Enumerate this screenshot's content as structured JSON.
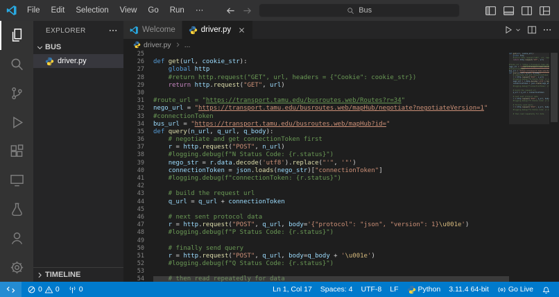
{
  "colors": {
    "accent": "#007acc",
    "titlebar_bg": "#323233",
    "activitybar_bg": "#333333",
    "sidebar_bg": "#252526",
    "editor_bg": "#1e1e1e",
    "tab_inactive_bg": "#2d2d2d",
    "statusbar_bg": "#007acc",
    "vscode_blue": "#29a9e1",
    "python_blue": "#3776ab",
    "python_yellow": "#ffd43b",
    "syntax": {
      "keyword": "#569cd6",
      "control": "#c586c0",
      "function": "#dcdcaa",
      "variable": "#9cdcfe",
      "string": "#ce9178",
      "comment": "#6a9955",
      "escape": "#d7ba7d",
      "punct": "#d4d4d4"
    }
  },
  "title_bar": {
    "menus": [
      "File",
      "Edit",
      "Selection",
      "View",
      "Go",
      "Run",
      "⋯"
    ],
    "nav": [
      "back-arrow-icon",
      "forward-arrow-icon"
    ],
    "search": {
      "value": "Bus",
      "icon": "search-icon"
    },
    "layout_icons": [
      "layout-sidebar-left-icon",
      "layout-panel-icon",
      "layout-sidebar-right-icon",
      "customize-layout-icon"
    ]
  },
  "activity_bar": {
    "items": [
      {
        "name": "explorer",
        "icon": "files-icon",
        "active": true
      },
      {
        "name": "search",
        "icon": "search-icon",
        "active": false
      },
      {
        "name": "source-control",
        "icon": "source-control-icon",
        "active": false
      },
      {
        "name": "run-and-debug",
        "icon": "run-and-debug-icon",
        "active": false
      },
      {
        "name": "extensions",
        "icon": "extensions-icon",
        "active": false
      },
      {
        "name": "remote-explorer",
        "icon": "remote-explorer-icon",
        "active": false
      },
      {
        "name": "testing",
        "icon": "testing-icon",
        "active": false
      }
    ],
    "bottom": [
      {
        "name": "account",
        "icon": "account-icon",
        "active": false
      },
      {
        "name": "settings",
        "icon": "settings-gear-icon",
        "active": false
      }
    ]
  },
  "sidebar": {
    "title": "EXPLORER",
    "folder": "BUS",
    "files": [
      {
        "name": "driver.py",
        "icon": "python-file-icon",
        "selected": true
      }
    ],
    "timeline": "TIMELINE"
  },
  "tabs": {
    "items": [
      {
        "label": "Welcome",
        "icon": "vscode-logo-icon",
        "active": false
      },
      {
        "label": "driver.py",
        "icon": "python-file-icon",
        "active": true
      }
    ]
  },
  "editor_actions": [
    "run-icon",
    "chevron-down-icon",
    "split-editor-icon",
    "ellipsis-icon"
  ],
  "breadcrumb": {
    "file": "driver.py",
    "more": "..."
  },
  "editor": {
    "lines": [
      {
        "n": "25",
        "s": []
      },
      {
        "n": "26",
        "s": [
          [
            "kw",
            "def"
          ],
          [
            "pl",
            " "
          ],
          [
            "fn",
            "get"
          ],
          [
            "pu",
            "("
          ],
          [
            "va",
            "url"
          ],
          [
            "pu",
            ", "
          ],
          [
            "va",
            "cookie_str"
          ],
          [
            "pu",
            "):"
          ]
        ]
      },
      {
        "n": "27",
        "s": [
          [
            "pl",
            "    "
          ],
          [
            "kw",
            "global"
          ],
          [
            "pl",
            " "
          ],
          [
            "va",
            "http"
          ]
        ]
      },
      {
        "n": "28",
        "s": [
          [
            "co",
            "    #return http.request(\"GET\", url, headers = {\"Cookie\": cookie_str})"
          ]
        ]
      },
      {
        "n": "29",
        "s": [
          [
            "pl",
            "    "
          ],
          [
            "ct",
            "return"
          ],
          [
            "pl",
            " "
          ],
          [
            "va",
            "http"
          ],
          [
            "pu",
            "."
          ],
          [
            "fn",
            "request"
          ],
          [
            "pu",
            "("
          ],
          [
            "st",
            "\"GET\""
          ],
          [
            "pu",
            ", "
          ],
          [
            "va",
            "url"
          ],
          [
            "pu",
            ")"
          ]
        ]
      },
      {
        "n": "30",
        "s": []
      },
      {
        "n": "31",
        "s": [
          [
            "co",
            "#route_url = \""
          ],
          [
            "cou",
            "https://transport.tamu.edu/busroutes.web/Routes?r=34"
          ],
          [
            "co",
            "\""
          ]
        ]
      },
      {
        "n": "32",
        "s": [
          [
            "va",
            "nego_url"
          ],
          [
            "pu",
            " = "
          ],
          [
            "st",
            "\""
          ],
          [
            "stu",
            "https://transport.tamu.edu/busroutes.web/mapHub/negotiate?negotiateVersion=1"
          ],
          [
            "st",
            "\""
          ]
        ]
      },
      {
        "n": "33",
        "s": [
          [
            "co",
            "#connectionToken"
          ]
        ]
      },
      {
        "n": "34",
        "s": [
          [
            "va",
            "bus_url"
          ],
          [
            "pu",
            " = "
          ],
          [
            "st",
            "\""
          ],
          [
            "stu",
            "https://transport.tamu.edu/busroutes.web/mapHub?id="
          ],
          [
            "st",
            "\""
          ]
        ]
      },
      {
        "n": "35",
        "s": [
          [
            "kw",
            "def"
          ],
          [
            "pl",
            " "
          ],
          [
            "fn",
            "query"
          ],
          [
            "pu",
            "("
          ],
          [
            "va",
            "n_url"
          ],
          [
            "pu",
            ", "
          ],
          [
            "va",
            "q_url"
          ],
          [
            "pu",
            ", "
          ],
          [
            "va",
            "q_body"
          ],
          [
            "pu",
            "):"
          ]
        ]
      },
      {
        "n": "36",
        "s": [
          [
            "co",
            "    # negotiate and get connectionToken first"
          ]
        ]
      },
      {
        "n": "37",
        "s": [
          [
            "pl",
            "    "
          ],
          [
            "va",
            "r"
          ],
          [
            "pu",
            " = "
          ],
          [
            "va",
            "http"
          ],
          [
            "pu",
            "."
          ],
          [
            "fn",
            "request"
          ],
          [
            "pu",
            "("
          ],
          [
            "st",
            "\"POST\""
          ],
          [
            "pu",
            ", "
          ],
          [
            "va",
            "n_url"
          ],
          [
            "pu",
            ")"
          ]
        ]
      },
      {
        "n": "38",
        "s": [
          [
            "co",
            "    #logging.debug(f\"N Status Code: {r.status}\")"
          ]
        ]
      },
      {
        "n": "39",
        "s": [
          [
            "pl",
            "    "
          ],
          [
            "va",
            "nego_str"
          ],
          [
            "pu",
            " = "
          ],
          [
            "va",
            "r"
          ],
          [
            "pu",
            "."
          ],
          [
            "va",
            "data"
          ],
          [
            "pu",
            "."
          ],
          [
            "fn",
            "decode"
          ],
          [
            "pu",
            "("
          ],
          [
            "st",
            "'utf8'"
          ],
          [
            "pu",
            ")."
          ],
          [
            "fn",
            "replace"
          ],
          [
            "pu",
            "("
          ],
          [
            "st",
            "\"'\""
          ],
          [
            "pu",
            ", "
          ],
          [
            "st",
            "'\"'"
          ],
          [
            "pu",
            ")"
          ]
        ]
      },
      {
        "n": "40",
        "s": [
          [
            "pl",
            "    "
          ],
          [
            "va",
            "connectionToken"
          ],
          [
            "pu",
            " = "
          ],
          [
            "va",
            "json"
          ],
          [
            "pu",
            "."
          ],
          [
            "fn",
            "loads"
          ],
          [
            "pu",
            "("
          ],
          [
            "va",
            "nego_str"
          ],
          [
            "pu",
            ")["
          ],
          [
            "st",
            "\"connectionToken\""
          ],
          [
            "pu",
            "]"
          ]
        ]
      },
      {
        "n": "41",
        "s": [
          [
            "co",
            "    #logging.debug(f\"connectionToken: {r.status}\")"
          ]
        ]
      },
      {
        "n": "42",
        "s": []
      },
      {
        "n": "43",
        "s": [
          [
            "co",
            "    # build the request url"
          ]
        ]
      },
      {
        "n": "44",
        "s": [
          [
            "pl",
            "    "
          ],
          [
            "va",
            "q_url"
          ],
          [
            "pu",
            " = "
          ],
          [
            "va",
            "q_url"
          ],
          [
            "pu",
            " + "
          ],
          [
            "va",
            "connectionToken"
          ]
        ]
      },
      {
        "n": "45",
        "s": []
      },
      {
        "n": "46",
        "s": [
          [
            "co",
            "    # next sent protocol data"
          ]
        ]
      },
      {
        "n": "47",
        "s": [
          [
            "pl",
            "    "
          ],
          [
            "va",
            "r"
          ],
          [
            "pu",
            " = "
          ],
          [
            "va",
            "http"
          ],
          [
            "pu",
            "."
          ],
          [
            "fn",
            "request"
          ],
          [
            "pu",
            "("
          ],
          [
            "st",
            "\"POST\""
          ],
          [
            "pu",
            ", "
          ],
          [
            "va",
            "q_url"
          ],
          [
            "pu",
            ", "
          ],
          [
            "va",
            "body"
          ],
          [
            "pu",
            "="
          ],
          [
            "st",
            "'{\"protocol\": \"json\", \"version\": 1}"
          ],
          [
            "es",
            "\\u001e"
          ],
          [
            "st",
            "'"
          ],
          [
            "pu",
            ")"
          ]
        ]
      },
      {
        "n": "48",
        "s": [
          [
            "co",
            "    #logging.debug(f\"P Status Code: {r.status}\")"
          ]
        ]
      },
      {
        "n": "49",
        "s": []
      },
      {
        "n": "50",
        "s": [
          [
            "co",
            "    # finally send query"
          ]
        ]
      },
      {
        "n": "51",
        "s": [
          [
            "pl",
            "    "
          ],
          [
            "va",
            "r"
          ],
          [
            "pu",
            " = "
          ],
          [
            "va",
            "http"
          ],
          [
            "pu",
            "."
          ],
          [
            "fn",
            "request"
          ],
          [
            "pu",
            "("
          ],
          [
            "st",
            "\"POST\""
          ],
          [
            "pu",
            ", "
          ],
          [
            "va",
            "q_url"
          ],
          [
            "pu",
            ", "
          ],
          [
            "va",
            "body"
          ],
          [
            "pu",
            "="
          ],
          [
            "va",
            "q_body"
          ],
          [
            "pu",
            " + "
          ],
          [
            "st",
            "'"
          ],
          [
            "es",
            "\\u001e"
          ],
          [
            "st",
            "'"
          ],
          [
            "pu",
            ")"
          ]
        ]
      },
      {
        "n": "52",
        "s": [
          [
            "co",
            "    #logging.debug(f\"Q Status Code: {r.status}\")"
          ]
        ]
      },
      {
        "n": "53",
        "s": []
      },
      {
        "n": "54",
        "s": [
          [
            "co",
            "    # then read repeatedly for data"
          ]
        ]
      }
    ]
  },
  "status_bar": {
    "left": [
      {
        "name": "remote-indicator",
        "parts": [
          {
            "icon": "remote-icon"
          }
        ]
      },
      {
        "name": "problems-indicator",
        "parts": [
          {
            "icon": "error-icon"
          },
          {
            "text": "0"
          },
          {
            "icon": "warning-icon"
          },
          {
            "text": "0"
          }
        ]
      },
      {
        "name": "ports-indicator",
        "parts": [
          {
            "icon": "radio-tower-icon"
          },
          {
            "text": "0"
          }
        ]
      }
    ],
    "right": [
      {
        "name": "cursor-position",
        "parts": [
          {
            "text": "Ln 1, Col 17"
          }
        ]
      },
      {
        "name": "indentation",
        "parts": [
          {
            "text": "Spaces: 4"
          }
        ]
      },
      {
        "name": "encoding",
        "parts": [
          {
            "text": "UTF-8"
          }
        ]
      },
      {
        "name": "eol-sequence",
        "parts": [
          {
            "text": "LF"
          }
        ]
      },
      {
        "name": "language-mode",
        "parts": [
          {
            "icon": "python-logo-icon"
          },
          {
            "text": "Python"
          }
        ]
      },
      {
        "name": "python-interpreter",
        "parts": [
          {
            "text": "3.11.4 64-bit"
          }
        ]
      },
      {
        "name": "go-live",
        "parts": [
          {
            "icon": "broadcast-icon"
          },
          {
            "text": "Go Live"
          }
        ]
      },
      {
        "name": "notifications",
        "parts": [
          {
            "icon": "bell-icon"
          }
        ]
      }
    ]
  }
}
